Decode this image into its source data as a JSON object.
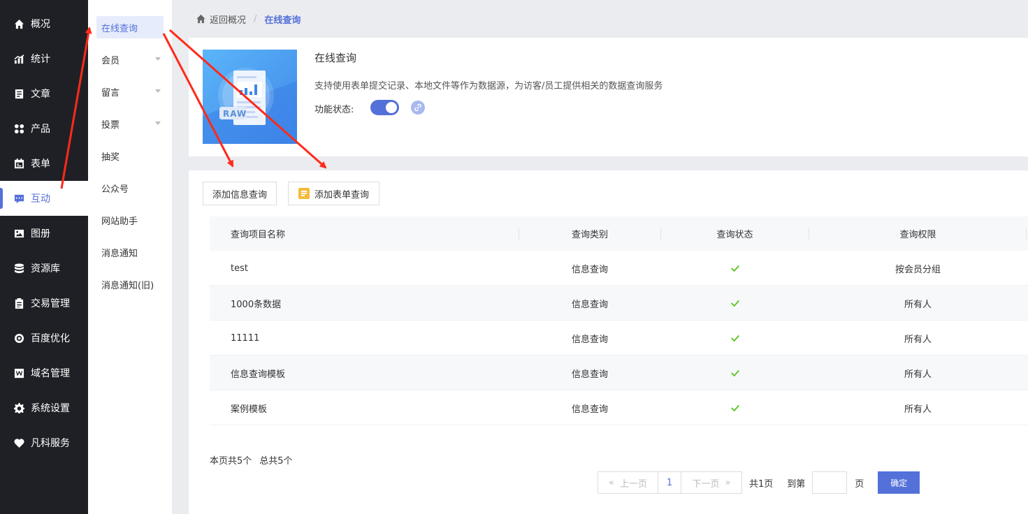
{
  "nav": {
    "items": [
      {
        "label": "概况",
        "icon": "home-icon"
      },
      {
        "label": "统计",
        "icon": "chart-icon"
      },
      {
        "label": "文章",
        "icon": "article-icon"
      },
      {
        "label": "产品",
        "icon": "grid-icon"
      },
      {
        "label": "表单",
        "icon": "calendar-icon"
      },
      {
        "label": "互动",
        "icon": "chat-icon"
      },
      {
        "label": "图册",
        "icon": "album-icon"
      },
      {
        "label": "资源库",
        "icon": "database-icon"
      },
      {
        "label": "交易管理",
        "icon": "clipboard-icon"
      },
      {
        "label": "百度优化",
        "icon": "target-icon"
      },
      {
        "label": "域名管理",
        "icon": "domain-icon"
      },
      {
        "label": "系统设置",
        "icon": "gear-icon"
      },
      {
        "label": "凡科服务",
        "icon": "heart-icon"
      }
    ]
  },
  "submenu": {
    "items": [
      {
        "label": "在线查询"
      },
      {
        "label": "会员"
      },
      {
        "label": "留言"
      },
      {
        "label": "投票"
      },
      {
        "label": "抽奖"
      },
      {
        "label": "公众号"
      },
      {
        "label": "网站助手"
      },
      {
        "label": "消息通知"
      },
      {
        "label": "消息通知(旧)"
      }
    ]
  },
  "breadcrumb": {
    "back": "返回概况",
    "separator": "/",
    "current": "在线查询"
  },
  "intro": {
    "banner_text": "RAW",
    "title": "在线查询",
    "description": "支持使用表单提交记录、本地文件等作为数据源，为访客/员工提供相关的数据查询服务",
    "state_label": "功能状态:"
  },
  "toolbar": {
    "add_info_query": "添加信息查询",
    "add_form_query": "添加表单查询"
  },
  "table": {
    "headers": [
      "查询项目名称",
      "查询类别",
      "查询状态",
      "查询权限"
    ],
    "rows": [
      {
        "name": "test",
        "type": "信息查询",
        "status": "✓",
        "permission": "按会员分组"
      },
      {
        "name": "1000条数据",
        "type": "信息查询",
        "status": "✓",
        "permission": "所有人"
      },
      {
        "name": "11111",
        "type": "信息查询",
        "status": "✓",
        "permission": "所有人"
      },
      {
        "name": "信息查询模板",
        "type": "信息查询",
        "status": "✓",
        "permission": "所有人"
      },
      {
        "name": "案例模板",
        "type": "信息查询",
        "status": "✓",
        "permission": "所有人"
      }
    ]
  },
  "summary": {
    "page_count": "本页共5个",
    "total_count": "总共5个"
  },
  "pagination": {
    "prev": "上一页",
    "current": "1",
    "next": "下一页",
    "total_pages": "共1页",
    "goto_label": "到第",
    "page_unit": "页",
    "confirm": "确定"
  },
  "colors": {
    "primary": "#5470d9",
    "sidebar_bg": "#1f2026",
    "success": "#52c41a",
    "annotation": "#ff2a1a"
  }
}
